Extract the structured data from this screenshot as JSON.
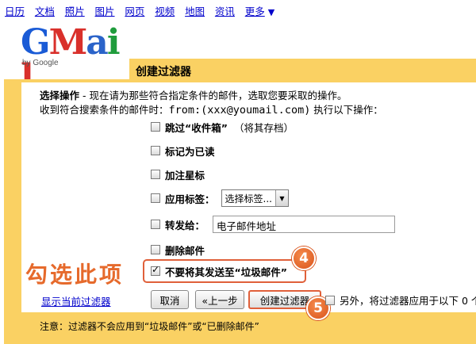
{
  "topnav": {
    "links": [
      "日历",
      "文档",
      "照片",
      "图片",
      "网页",
      "视频",
      "地图",
      "资讯",
      "更多"
    ],
    "more_arrow": "▼"
  },
  "logo": {
    "letters": [
      "G",
      "M",
      "a",
      "i",
      "l"
    ],
    "letter_colors": [
      "#1a5bd6",
      "#d9302b",
      "#2a63c9",
      "#1f9c3c",
      "#d9302b"
    ],
    "byline": "by Google"
  },
  "header": {
    "title": "创建过滤器"
  },
  "intro": {
    "label": "选择操作",
    "text": " - 现在请为那些符合指定条件的邮件，选取您要采取的操作。",
    "line2_prefix": "收到符合搜索条件的邮件时：",
    "query": "from:(xxx@youmail.com)",
    "line2_suffix": " 执行以下操作："
  },
  "options": {
    "skip_inbox": {
      "label": "跳过“收件箱”",
      "note": "（将其存档）",
      "checked": false
    },
    "mark_read": {
      "label": "标记为已读",
      "checked": false
    },
    "star": {
      "label": "加注星标",
      "checked": false
    },
    "apply_label": {
      "label": "应用标签：",
      "select_value": "选择标签...",
      "checked": false
    },
    "forward": {
      "label": "转发给：",
      "input_value": "电子邮件地址",
      "checked": false
    },
    "delete": {
      "label": "删除邮件",
      "checked": false
    },
    "never_spam": {
      "label": "不要将其发送至“垃圾邮件”",
      "checked": true
    }
  },
  "annotation": {
    "text": "勾选此项",
    "step4": "4",
    "step5": "5",
    "accent": "#e66a2c"
  },
  "buttons": {
    "show_current": "显示当前过滤器",
    "cancel": "取消",
    "back": "«上一步",
    "create": "创建过滤器"
  },
  "also_apply": {
    "text": "另外，将过滤器应用于以下 0 个",
    "checked": false
  },
  "footer_note": "注意：过滤器不会应用到“垃圾邮件”或“已删除邮件”",
  "colors": {
    "panel": "#fad163",
    "link": "#0000cc"
  }
}
